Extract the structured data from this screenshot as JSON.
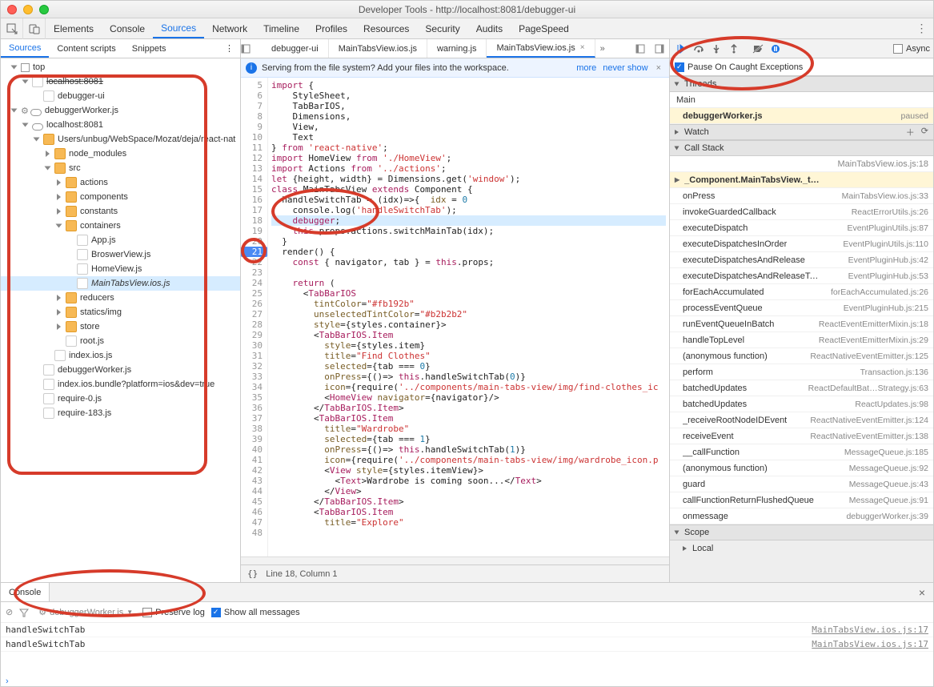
{
  "window_title": "Developer Tools - http://localhost:8081/debugger-ui",
  "main_tabs": [
    "Elements",
    "Console",
    "Sources",
    "Network",
    "Timeline",
    "Profiles",
    "Resources",
    "Security",
    "Audits",
    "PageSpeed"
  ],
  "main_tab_active": "Sources",
  "left_tabs": [
    "Sources",
    "Content scripts",
    "Snippets"
  ],
  "left_tab_active": "Sources",
  "file_tree": {
    "top": "top",
    "nodes": [
      {
        "d": 1,
        "a": "open",
        "i": "box",
        "t": "top"
      },
      {
        "d": 2,
        "a": "open",
        "i": "file",
        "t": "localhost:8081",
        "strike": true
      },
      {
        "d": 3,
        "a": "none",
        "i": "file",
        "t": "debugger-ui"
      },
      {
        "d": 1,
        "a": "open",
        "i": "cloud",
        "t": "debuggerWorker.js",
        "mini": "⚙"
      },
      {
        "d": 2,
        "a": "open",
        "i": "cloud",
        "t": "localhost:8081"
      },
      {
        "d": 3,
        "a": "open",
        "i": "folder",
        "t": "Users/unbug/WebSpace/Mozat/deja/react-nat"
      },
      {
        "d": 4,
        "a": "closed",
        "i": "folder",
        "t": "node_modules"
      },
      {
        "d": 4,
        "a": "open",
        "i": "folder",
        "t": "src"
      },
      {
        "d": 5,
        "a": "closed",
        "i": "folder",
        "t": "actions"
      },
      {
        "d": 5,
        "a": "closed",
        "i": "folder",
        "t": "components"
      },
      {
        "d": 5,
        "a": "closed",
        "i": "folder",
        "t": "constants"
      },
      {
        "d": 5,
        "a": "open",
        "i": "folder",
        "t": "containers"
      },
      {
        "d": 6,
        "a": "none",
        "i": "file",
        "t": "App.js"
      },
      {
        "d": 6,
        "a": "none",
        "i": "file",
        "t": "BroswerView.js"
      },
      {
        "d": 6,
        "a": "none",
        "i": "file",
        "t": "HomeView.js"
      },
      {
        "d": 6,
        "a": "none",
        "i": "file",
        "t": "MainTabsView.ios.js",
        "sel": true
      },
      {
        "d": 5,
        "a": "closed",
        "i": "folder",
        "t": "reducers"
      },
      {
        "d": 5,
        "a": "closed",
        "i": "folder",
        "t": "statics/img"
      },
      {
        "d": 5,
        "a": "closed",
        "i": "folder",
        "t": "store"
      },
      {
        "d": 5,
        "a": "none",
        "i": "file",
        "t": "root.js"
      },
      {
        "d": 4,
        "a": "none",
        "i": "file",
        "t": "index.ios.js"
      },
      {
        "d": 3,
        "a": "none",
        "i": "file",
        "t": "debuggerWorker.js"
      },
      {
        "d": 3,
        "a": "none",
        "i": "file",
        "t": "index.ios.bundle?platform=ios&dev=true"
      },
      {
        "d": 3,
        "a": "none",
        "i": "file",
        "t": "require-0.js"
      },
      {
        "d": 3,
        "a": "none",
        "i": "file",
        "t": "require-183.js"
      }
    ]
  },
  "file_tabs": [
    {
      "label": "debugger-ui"
    },
    {
      "label": "MainTabsView.ios.js"
    },
    {
      "label": "warning.js"
    },
    {
      "label": "MainTabsView.ios.js",
      "active": true,
      "close": true
    }
  ],
  "info_bar": {
    "text": "Serving from the file system? Add your files into the workspace.",
    "links": [
      "more",
      "never show"
    ]
  },
  "code": {
    "start": 5,
    "lines": [
      {
        "n": 5,
        "h": "<span class=kw>import</span> {"
      },
      {
        "n": 6,
        "h": "    StyleSheet,"
      },
      {
        "n": 7,
        "h": "    TabBarIOS,"
      },
      {
        "n": 8,
        "h": "    Dimensions,"
      },
      {
        "n": 9,
        "h": "    View,"
      },
      {
        "n": 10,
        "h": "    Text"
      },
      {
        "n": 11,
        "h": "} <span class=kw>from</span> <span class=str>'react-native'</span>;"
      },
      {
        "n": 12,
        "h": "<span class=kw>import</span> HomeView <span class=kw>from</span> <span class=str>'./HomeView'</span>;"
      },
      {
        "n": 13,
        "h": "<span class=kw>import</span> Actions <span class=kw>from</span> <span class=str>'../actions'</span>;"
      },
      {
        "n": 14,
        "h": "<span class=kw>let</span> {height, width} = Dimensions.get(<span class=str>'window'</span>);"
      },
      {
        "n": 15,
        "h": "<span class=kw>class</span> MainTabsView <span class=kw>extends</span> Component {"
      },
      {
        "n": 16,
        "h": "  handleSwitchTab = (idx)=>{  <span class=id>idx</span> = <span class=num>0</span>"
      },
      {
        "n": 17,
        "h": "    console.log(<span class=str>'handleSwitchTab'</span>);"
      },
      {
        "n": 18,
        "h": "    <span class=kw>debugger</span>;",
        "exec": true
      },
      {
        "n": 19,
        "h": "    <span class=kw>this</span>.props.actions.switchMainTab(idx);"
      },
      {
        "n": 20,
        "h": "  }"
      },
      {
        "n": 21,
        "h": "  render() {",
        "bp": true
      },
      {
        "n": 22,
        "h": "    <span class=kw>const</span> { navigator, tab } = <span class=kw>this</span>.props;"
      },
      {
        "n": 23,
        "h": ""
      },
      {
        "n": 24,
        "h": "    <span class=kw>return</span> ("
      },
      {
        "n": 25,
        "h": "      &lt;<span class=tg>TabBarIOS</span>"
      },
      {
        "n": 26,
        "h": "        <span class=prop>tintColor</span>=<span class=str>\"#fb192b\"</span>"
      },
      {
        "n": 27,
        "h": "        <span class=prop>unselectedTintColor</span>=<span class=str>\"#b2b2b2\"</span>"
      },
      {
        "n": 28,
        "h": "        <span class=prop>style</span>={styles.container}&gt;"
      },
      {
        "n": 29,
        "h": "        &lt;<span class=tg>TabBarIOS.Item</span>"
      },
      {
        "n": 30,
        "h": "          <span class=prop>style</span>={styles.item}"
      },
      {
        "n": 31,
        "h": "          <span class=prop>title</span>=<span class=str>\"Find Clothes\"</span>"
      },
      {
        "n": 32,
        "h": "          <span class=prop>selected</span>={tab === <span class=num>0</span>}"
      },
      {
        "n": 33,
        "h": "          <span class=prop>onPress</span>={()=> <span class=kw>this</span>.handleSwitchTab(<span class=num>0</span>)}"
      },
      {
        "n": 34,
        "h": "          <span class=prop>icon</span>={require(<span class=str>'../components/main-tabs-view/img/find-clothes_ic</span>"
      },
      {
        "n": 35,
        "h": "          &lt;<span class=tg>HomeView</span> <span class=prop>navigator</span>={navigator}/&gt;"
      },
      {
        "n": 36,
        "h": "        &lt;/<span class=tg>TabBarIOS.Item</span>&gt;"
      },
      {
        "n": 37,
        "h": "        &lt;<span class=tg>TabBarIOS.Item</span>"
      },
      {
        "n": 38,
        "h": "          <span class=prop>title</span>=<span class=str>\"Wardrobe\"</span>"
      },
      {
        "n": 39,
        "h": "          <span class=prop>selected</span>={tab === <span class=num>1</span>}"
      },
      {
        "n": 40,
        "h": "          <span class=prop>onPress</span>={()=> <span class=kw>this</span>.handleSwitchTab(<span class=num>1</span>)}"
      },
      {
        "n": 41,
        "h": "          <span class=prop>icon</span>={require(<span class=str>'../components/main-tabs-view/img/wardrobe_icon.p</span>"
      },
      {
        "n": 42,
        "h": "          &lt;<span class=tg>View</span> <span class=prop>style</span>={styles.itemView}&gt;"
      },
      {
        "n": 43,
        "h": "            &lt;<span class=tg>Text</span>&gt;Wardrobe is coming soon...&lt;/<span class=tg>Text</span>&gt;"
      },
      {
        "n": 44,
        "h": "          &lt;/<span class=tg>View</span>&gt;"
      },
      {
        "n": 45,
        "h": "        &lt;/<span class=tg>TabBarIOS.Item</span>&gt;"
      },
      {
        "n": 46,
        "h": "        &lt;<span class=tg>TabBarIOS.Item</span>"
      },
      {
        "n": 47,
        "h": "          <span class=prop>title</span>=<span class=str>\"Explore\"</span>"
      },
      {
        "n": 48,
        "h": ""
      }
    ]
  },
  "status": {
    "pos": "Line 18, Column 1"
  },
  "dbg": {
    "async_label": "Async",
    "pause_caught": "Pause On Caught Exceptions",
    "threads_label": "Threads",
    "main_label": "Main",
    "worker": {
      "name": "debuggerWorker.js",
      "status": "paused"
    },
    "watch_label": "Watch",
    "callstack_label": "Call Stack",
    "frames": [
      {
        "fn": "",
        "loc": "MainTabsView.ios.js:18",
        "head": true
      },
      {
        "fn": "_Component.MainTabsView._this.handleSwitchTab",
        "loc": "",
        "hi": true
      },
      {
        "fn": "onPress",
        "loc": "MainTabsView.ios.js:33"
      },
      {
        "fn": "invokeGuardedCallback",
        "loc": "ReactErrorUtils.js:26"
      },
      {
        "fn": "executeDispatch",
        "loc": "EventPluginUtils.js:87"
      },
      {
        "fn": "executeDispatchesInOrder",
        "loc": "EventPluginUtils.js:110"
      },
      {
        "fn": "executeDispatchesAndRelease",
        "loc": "EventPluginHub.js:42"
      },
      {
        "fn": "executeDispatchesAndReleaseTopLevel",
        "loc": "EventPluginHub.js:53"
      },
      {
        "fn": "forEachAccumulated",
        "loc": "forEachAccumulated.js:26"
      },
      {
        "fn": "processEventQueue",
        "loc": "EventPluginHub.js:215"
      },
      {
        "fn": "runEventQueueInBatch",
        "loc": "ReactEventEmitterMixin.js:18"
      },
      {
        "fn": "handleTopLevel",
        "loc": "ReactEventEmitterMixin.js:29"
      },
      {
        "fn": "(anonymous function)",
        "loc": "ReactNativeEventEmitter.js:125"
      },
      {
        "fn": "perform",
        "loc": "Transaction.js:136"
      },
      {
        "fn": "batchedUpdates",
        "loc": "ReactDefaultBat…Strategy.js:63"
      },
      {
        "fn": "batchedUpdates",
        "loc": "ReactUpdates.js:98"
      },
      {
        "fn": "_receiveRootNodeIDEvent",
        "loc": "ReactNativeEventEmitter.js:124"
      },
      {
        "fn": "receiveEvent",
        "loc": "ReactNativeEventEmitter.js:138"
      },
      {
        "fn": "__callFunction",
        "loc": "MessageQueue.js:185"
      },
      {
        "fn": "(anonymous function)",
        "loc": "MessageQueue.js:92"
      },
      {
        "fn": "guard",
        "loc": "MessageQueue.js:43"
      },
      {
        "fn": "callFunctionReturnFlushedQueue",
        "loc": "MessageQueue.js:91"
      },
      {
        "fn": "onmessage",
        "loc": "debuggerWorker.js:39"
      }
    ],
    "scope_label": "Scope",
    "local_label": "Local"
  },
  "console": {
    "tab": "Console",
    "frame": "debuggerWorker.js",
    "preserve": "Preserve log",
    "showall": "Show all messages",
    "rows": [
      {
        "msg": "handleSwitchTab",
        "loc": "MainTabsView.ios.js:17"
      },
      {
        "msg": "handleSwitchTab",
        "loc": "MainTabsView.ios.js:17"
      }
    ]
  }
}
